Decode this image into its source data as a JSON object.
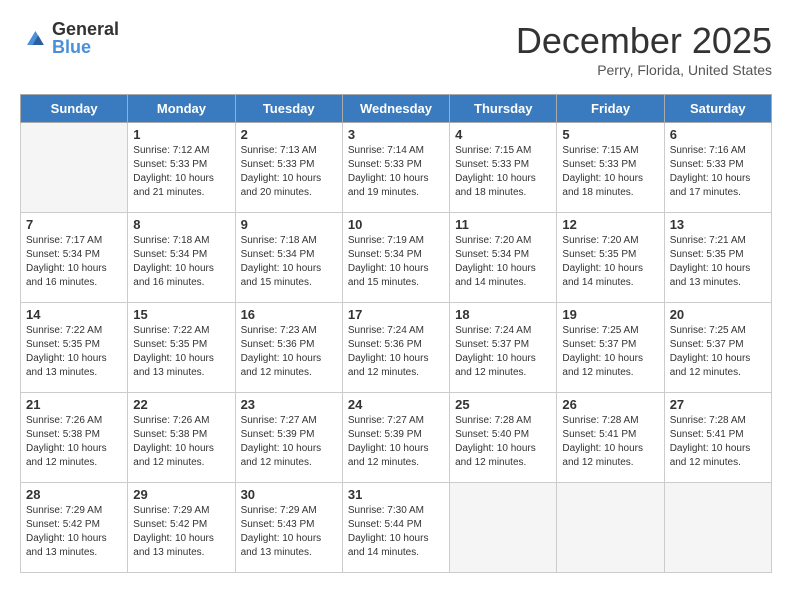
{
  "logo": {
    "text_general": "General",
    "text_blue": "Blue"
  },
  "title": "December 2025",
  "subtitle": "Perry, Florida, United States",
  "days_of_week": [
    "Sunday",
    "Monday",
    "Tuesday",
    "Wednesday",
    "Thursday",
    "Friday",
    "Saturday"
  ],
  "weeks": [
    [
      {
        "day": "",
        "info": ""
      },
      {
        "day": "1",
        "info": "Sunrise: 7:12 AM\nSunset: 5:33 PM\nDaylight: 10 hours\nand 21 minutes."
      },
      {
        "day": "2",
        "info": "Sunrise: 7:13 AM\nSunset: 5:33 PM\nDaylight: 10 hours\nand 20 minutes."
      },
      {
        "day": "3",
        "info": "Sunrise: 7:14 AM\nSunset: 5:33 PM\nDaylight: 10 hours\nand 19 minutes."
      },
      {
        "day": "4",
        "info": "Sunrise: 7:15 AM\nSunset: 5:33 PM\nDaylight: 10 hours\nand 18 minutes."
      },
      {
        "day": "5",
        "info": "Sunrise: 7:15 AM\nSunset: 5:33 PM\nDaylight: 10 hours\nand 18 minutes."
      },
      {
        "day": "6",
        "info": "Sunrise: 7:16 AM\nSunset: 5:33 PM\nDaylight: 10 hours\nand 17 minutes."
      }
    ],
    [
      {
        "day": "7",
        "info": "Sunrise: 7:17 AM\nSunset: 5:34 PM\nDaylight: 10 hours\nand 16 minutes."
      },
      {
        "day": "8",
        "info": "Sunrise: 7:18 AM\nSunset: 5:34 PM\nDaylight: 10 hours\nand 16 minutes."
      },
      {
        "day": "9",
        "info": "Sunrise: 7:18 AM\nSunset: 5:34 PM\nDaylight: 10 hours\nand 15 minutes."
      },
      {
        "day": "10",
        "info": "Sunrise: 7:19 AM\nSunset: 5:34 PM\nDaylight: 10 hours\nand 15 minutes."
      },
      {
        "day": "11",
        "info": "Sunrise: 7:20 AM\nSunset: 5:34 PM\nDaylight: 10 hours\nand 14 minutes."
      },
      {
        "day": "12",
        "info": "Sunrise: 7:20 AM\nSunset: 5:35 PM\nDaylight: 10 hours\nand 14 minutes."
      },
      {
        "day": "13",
        "info": "Sunrise: 7:21 AM\nSunset: 5:35 PM\nDaylight: 10 hours\nand 13 minutes."
      }
    ],
    [
      {
        "day": "14",
        "info": "Sunrise: 7:22 AM\nSunset: 5:35 PM\nDaylight: 10 hours\nand 13 minutes."
      },
      {
        "day": "15",
        "info": "Sunrise: 7:22 AM\nSunset: 5:35 PM\nDaylight: 10 hours\nand 13 minutes."
      },
      {
        "day": "16",
        "info": "Sunrise: 7:23 AM\nSunset: 5:36 PM\nDaylight: 10 hours\nand 12 minutes."
      },
      {
        "day": "17",
        "info": "Sunrise: 7:24 AM\nSunset: 5:36 PM\nDaylight: 10 hours\nand 12 minutes."
      },
      {
        "day": "18",
        "info": "Sunrise: 7:24 AM\nSunset: 5:37 PM\nDaylight: 10 hours\nand 12 minutes."
      },
      {
        "day": "19",
        "info": "Sunrise: 7:25 AM\nSunset: 5:37 PM\nDaylight: 10 hours\nand 12 minutes."
      },
      {
        "day": "20",
        "info": "Sunrise: 7:25 AM\nSunset: 5:37 PM\nDaylight: 10 hours\nand 12 minutes."
      }
    ],
    [
      {
        "day": "21",
        "info": "Sunrise: 7:26 AM\nSunset: 5:38 PM\nDaylight: 10 hours\nand 12 minutes."
      },
      {
        "day": "22",
        "info": "Sunrise: 7:26 AM\nSunset: 5:38 PM\nDaylight: 10 hours\nand 12 minutes."
      },
      {
        "day": "23",
        "info": "Sunrise: 7:27 AM\nSunset: 5:39 PM\nDaylight: 10 hours\nand 12 minutes."
      },
      {
        "day": "24",
        "info": "Sunrise: 7:27 AM\nSunset: 5:39 PM\nDaylight: 10 hours\nand 12 minutes."
      },
      {
        "day": "25",
        "info": "Sunrise: 7:28 AM\nSunset: 5:40 PM\nDaylight: 10 hours\nand 12 minutes."
      },
      {
        "day": "26",
        "info": "Sunrise: 7:28 AM\nSunset: 5:41 PM\nDaylight: 10 hours\nand 12 minutes."
      },
      {
        "day": "27",
        "info": "Sunrise: 7:28 AM\nSunset: 5:41 PM\nDaylight: 10 hours\nand 12 minutes."
      }
    ],
    [
      {
        "day": "28",
        "info": "Sunrise: 7:29 AM\nSunset: 5:42 PM\nDaylight: 10 hours\nand 13 minutes."
      },
      {
        "day": "29",
        "info": "Sunrise: 7:29 AM\nSunset: 5:42 PM\nDaylight: 10 hours\nand 13 minutes."
      },
      {
        "day": "30",
        "info": "Sunrise: 7:29 AM\nSunset: 5:43 PM\nDaylight: 10 hours\nand 13 minutes."
      },
      {
        "day": "31",
        "info": "Sunrise: 7:30 AM\nSunset: 5:44 PM\nDaylight: 10 hours\nand 14 minutes."
      },
      {
        "day": "",
        "info": ""
      },
      {
        "day": "",
        "info": ""
      },
      {
        "day": "",
        "info": ""
      }
    ]
  ]
}
